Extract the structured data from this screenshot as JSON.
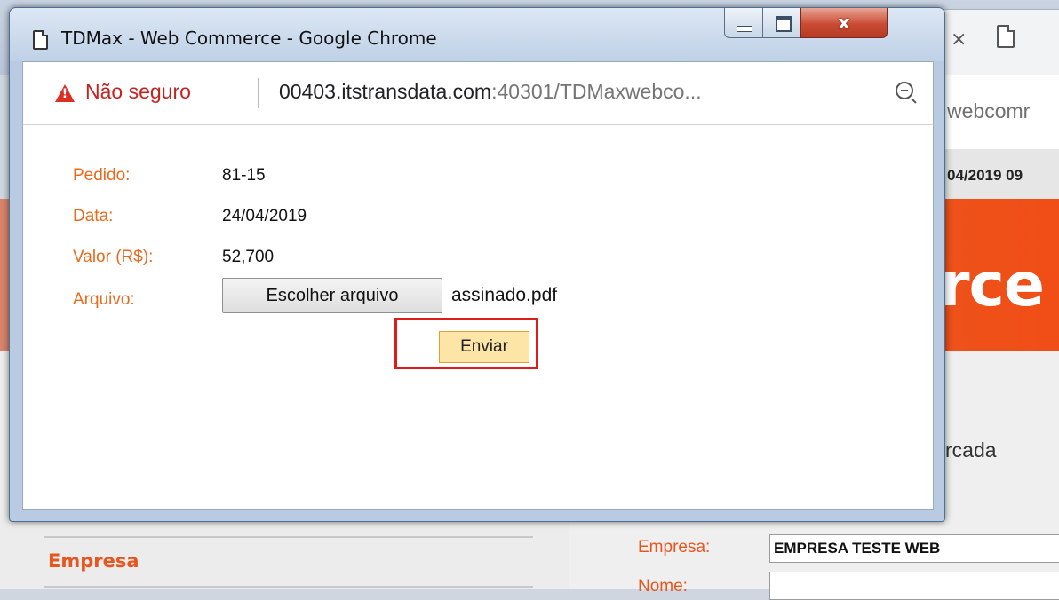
{
  "popup": {
    "title": "TDMax - Web Commerce - Google Chrome",
    "window_controls": {
      "close_label": "x"
    },
    "address_bar": {
      "security_label": "Não seguro",
      "url_host": "00403.itstransdata.com",
      "url_rest": ":40301/TDMaxwebco..."
    },
    "form": {
      "fields": [
        {
          "label": "Pedido:",
          "value": "81-15"
        },
        {
          "label": "Data:",
          "value": "24/04/2019"
        },
        {
          "label": "Valor (R$):",
          "value": "52,700"
        }
      ],
      "file_label": "Arquivo:",
      "file_button_label": "Escolher arquivo",
      "file_name": "assinado.pdf",
      "submit_label": "Enviar"
    }
  },
  "background": {
    "tab_close": "×",
    "url_fragment": "webcomr",
    "date_fragment": "04/2019 09",
    "banner_fragment": "rce",
    "marcada_fragment": "rcada",
    "sidebar_heading": "Empresa",
    "form": {
      "empresa_label": "Empresa:",
      "empresa_value": "EMPRESA TESTE WEB",
      "nome_label": "Nome:"
    }
  },
  "colors": {
    "accent_orange": "#e86a1e",
    "warning_red": "#d93025",
    "highlight_red": "#e01b1b",
    "submit_bg": "#fde4a7"
  }
}
